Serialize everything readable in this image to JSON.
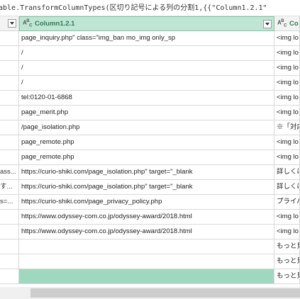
{
  "formula_bar": {
    "text": "able.TransformColumnTypes(区切り記号による列の分割1,{{\"Column1.2.1\""
  },
  "columns": {
    "main_label": "Column1.2.1",
    "main_type": "ABC",
    "right_label": "Co",
    "right_type": "ABC"
  },
  "rows": [
    {
      "left": "",
      "main": "page_inquiry.php\" class=\"img_ban mo_img only_sp",
      "right": "<img lo"
    },
    {
      "left": "",
      "main": "/",
      "right": "<img lo"
    },
    {
      "left": "",
      "main": "/",
      "right": "<img lo"
    },
    {
      "left": "",
      "main": "/",
      "right": "<img lo"
    },
    {
      "left": "",
      "main": "tel:0120-01-6868",
      "right": "<img lo"
    },
    {
      "left": "",
      "main": "page_merit.php",
      "right": "<img lo"
    },
    {
      "left": "",
      "main": "/page_isolation.php",
      "right": "※「対応"
    },
    {
      "left": "",
      "main": "page_remote.php",
      "right": "<img lo"
    },
    {
      "left": "",
      "main": "page_remote.php",
      "right": "<img lo"
    },
    {
      "left": "ass...",
      "main": "https://curio-shiki.com/page_isolation.php\" target=\"_blank",
      "right": "詳しくは"
    },
    {
      "left": "す...",
      "main": "https://curio-shiki.com/page_isolation.php\" target=\"_blank",
      "right": "詳しくは"
    },
    {
      "left": "s=...",
      "main": "https://curio-shiki.com/page_privacy_policy.php",
      "right": "プライバ"
    },
    {
      "left": "",
      "main": "https://www.odyssey-com.co.jp/odyssey-award/2018.html",
      "right": "<img lo"
    },
    {
      "left": "",
      "main": "https://www.odyssey-com.co.jp/odyssey-award/2018.html",
      "right": "<img lo"
    },
    {
      "left": "",
      "main": "",
      "right": "もっと見"
    },
    {
      "left": "",
      "main": "",
      "right": "もっと見"
    },
    {
      "left": "",
      "main": "",
      "right": "もっと見"
    }
  ]
}
